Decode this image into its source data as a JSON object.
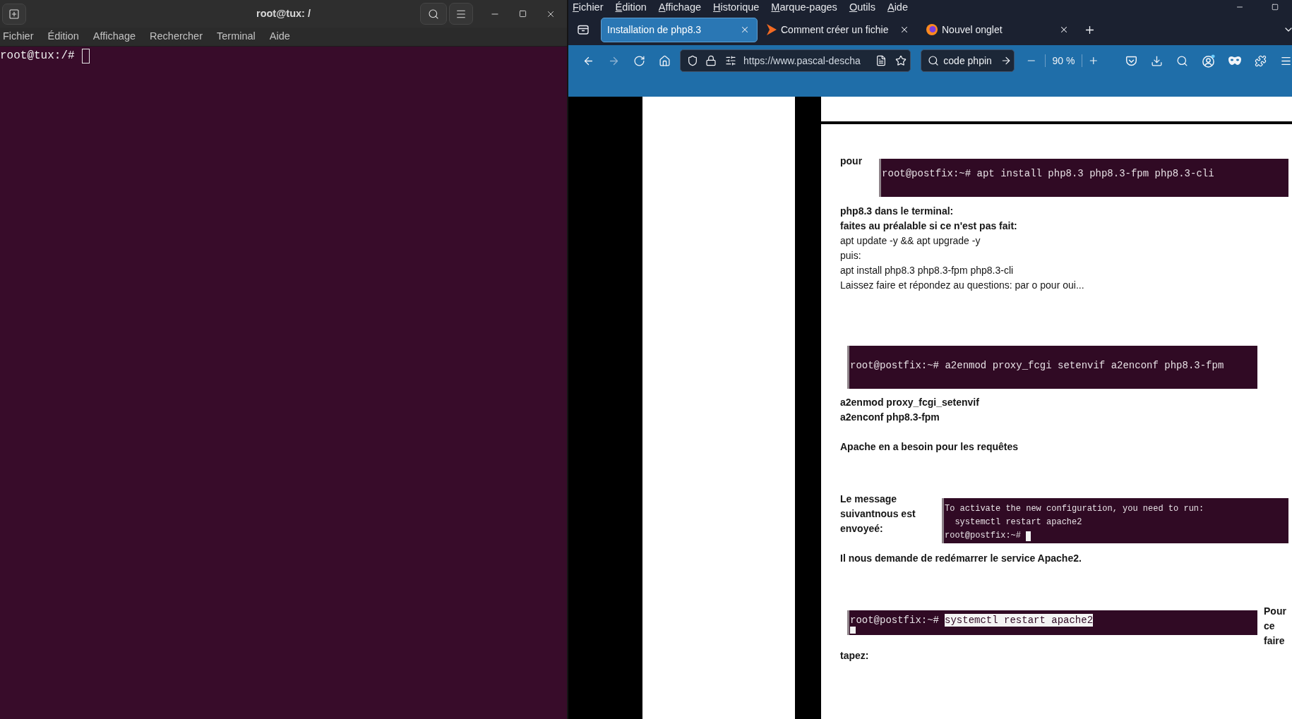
{
  "terminal": {
    "title": "root@tux: /",
    "menu": [
      "Fichier",
      "Édition",
      "Affichage",
      "Rechercher",
      "Terminal",
      "Aide"
    ],
    "prompt": "root@tux:/#"
  },
  "browser": {
    "menu": [
      "Fichier",
      "Édition",
      "Affichage",
      "Historique",
      "Marque-pages",
      "Outils",
      "Aide"
    ],
    "tabs": [
      {
        "label": "Installation de php8.3",
        "kind": "plain",
        "selected": true
      },
      {
        "label": "Comment créer un fichie",
        "kind": "site",
        "selected": false
      },
      {
        "label": "Nouvel onglet",
        "kind": "newtab",
        "selected": false
      }
    ],
    "nav": [
      {
        "kind": "back",
        "disabled": false
      },
      {
        "kind": "forward",
        "disabled": true
      },
      {
        "kind": "reload",
        "disabled": false
      },
      {
        "kind": "home",
        "disabled": false
      }
    ],
    "address": "https://www.pascal-descha",
    "search": {
      "value": "code phpin"
    },
    "zoom": "90 %"
  },
  "article": [
    {
      "kind": "labelled",
      "caption": "pour",
      "shot": {
        "lines": [
          {
            "text": "root@postfix:~# apt install php8.3 php8.3-fpm php8.3-cli",
            "cursor": false
          }
        ]
      }
    },
    {
      "kind": "paragraph",
      "lines": [
        {
          "text": "php8.3 dans le terminal:",
          "bold": true
        },
        {
          "text": "faites au préalable si ce n'est pas fait:",
          "bold": true
        },
        {
          "text": "apt update -y && apt upgrade -y",
          "bold": false
        },
        {
          "text": "puis:",
          "bold": false
        },
        {
          "text": "apt install php8.3 php8.3-fpm php8.3-cli",
          "bold": false
        },
        {
          "text": "Laissez faire et répondez au questions: par o pour oui...",
          "bold": false
        }
      ]
    },
    {
      "kind": "shot",
      "shot": {
        "lines": [
          {
            "text": "root@postfix:~# a2enmod proxy_fcgi setenvif a2enconf php8.3-fpm",
            "cursor": false
          }
        ]
      }
    },
    {
      "kind": "paragraph",
      "lines": [
        {
          "text": "a2enmod proxy_fcgi_setenvif",
          "bold": true
        },
        {
          "text": "a2enconf php8.3-fpm",
          "bold": true
        }
      ]
    },
    {
      "kind": "paragraph",
      "lines": [
        {
          "text": "Apache en a besoin pour les requêtes",
          "bold": true
        }
      ]
    },
    {
      "kind": "labelled",
      "caption": "Le message suivantnous est envoyeé:",
      "shot": {
        "lines": [
          {
            "text": "To activate the new configuration, you need to run:",
            "cursor": false
          },
          {
            "text": "  systemctl restart apache2",
            "cursor": false
          },
          {
            "text": "root@postfix:~#",
            "cursor": true
          }
        ]
      }
    },
    {
      "kind": "paragraph",
      "lines": [
        {
          "text": "Il nous demande de redémarrer le service Apache2.",
          "bold": true
        }
      ]
    },
    {
      "kind": "annotated",
      "caption": "Pour ce faire",
      "shot": {
        "lines": [
          {
            "text": "root@postfix:~#",
            "selection": "systemctl restart apache2",
            "cursor": false
          }
        ],
        "cursor_below": true
      }
    },
    {
      "kind": "paragraph",
      "lines": [
        {
          "text": "tapez:",
          "bold": true
        }
      ]
    }
  ]
}
